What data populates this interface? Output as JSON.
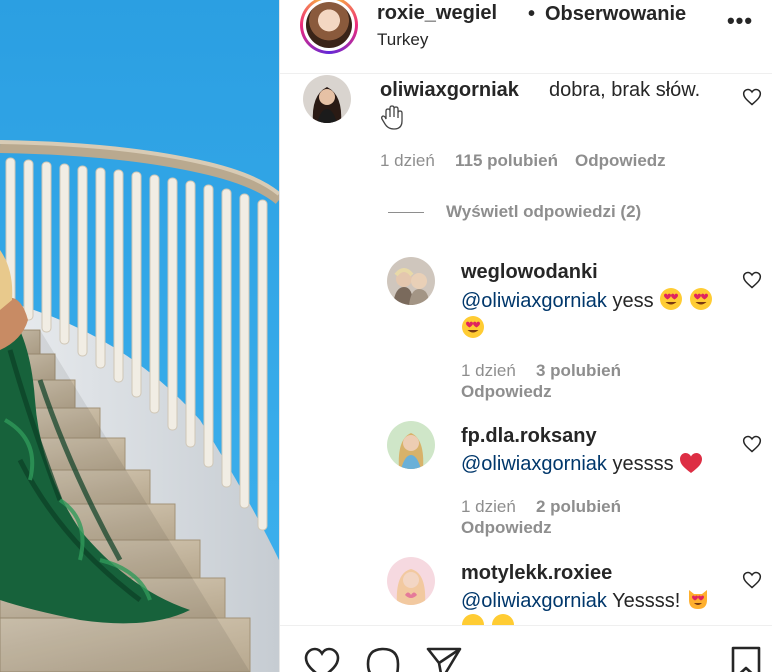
{
  "post": {
    "owner": "roxie_wegiel",
    "location": "Turkey",
    "dot": "•",
    "follow_label": "Obserwowanie",
    "more_label": "•••"
  },
  "comment": {
    "username": "oliwiaxgorniak",
    "text": "dobra, brak słów.",
    "time": "1 dzień",
    "likes": "115 polubień",
    "reply": "Odpowiedz"
  },
  "view_replies_label": "Wyświetl odpowiedzi (2)",
  "replies": [
    {
      "username": "weglowodanki",
      "mention": "@oliwiaxgorniak",
      "text": " yess",
      "time": "1 dzień",
      "likes": "3 polubień",
      "reply": "Odpowiedz"
    },
    {
      "username": "fp.dla.roksany",
      "mention": "@oliwiaxgorniak",
      "text": " yessss",
      "time": "1 dzień",
      "likes": "2 polubień",
      "reply": "Odpowiedz"
    },
    {
      "username": "motylekk.roxiee",
      "mention": "@oliwiaxgorniak",
      "text": " Yessss!"
    }
  ],
  "icons": {
    "like": "heart-outline-icon",
    "comment": "comment-bubble-icon",
    "share": "paper-plane-icon",
    "save": "bookmark-icon"
  },
  "colors": {
    "mention": "#00376b",
    "meta": "#8e8e8e",
    "sky": "#2fa6e6"
  }
}
